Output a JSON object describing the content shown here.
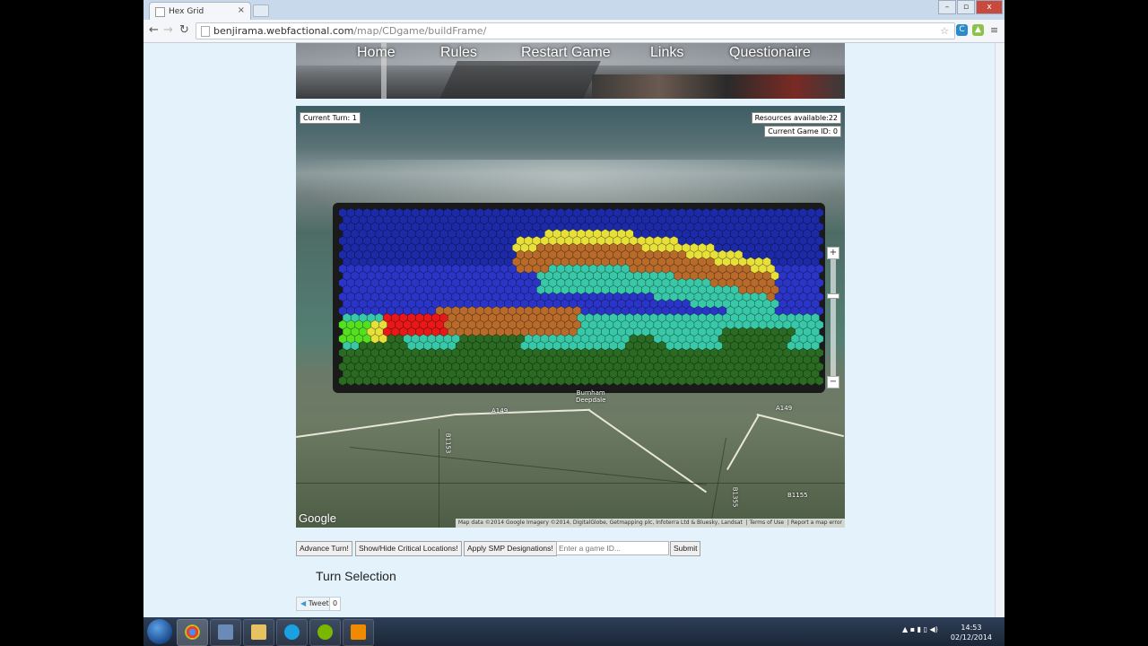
{
  "browser": {
    "tab_title": "Hex Grid",
    "tab_close": "×",
    "url_host": "benjirama.webfactional.com",
    "url_path": "/map/CDgame/buildFrame/",
    "win_min": "–",
    "win_max": "▫",
    "win_close": "x"
  },
  "nav": {
    "items": [
      "Home",
      "Rules",
      "Restart Game",
      "Links",
      "Questionaire"
    ]
  },
  "map": {
    "current_turn": "Current Turn: 1",
    "resources": "Resources available:22",
    "game_id": "Current Game ID: 0",
    "place_label": "Burnham\nDeepdale",
    "road_labels": [
      "A149",
      "A149",
      "B1153",
      "B1155",
      "B1355"
    ],
    "google_logo": "Google",
    "attribution": "Map data ©2014 Google Imagery ©2014, DigitalGlobe, Getmapping plc, Infoterra Ltd & Bluesky, Landsat",
    "terms": "Terms of Use",
    "report": "Report a map error",
    "zoom_in": "+",
    "zoom_out": "−"
  },
  "controls": {
    "advance": "Advance Turn!",
    "show_hide": "Show/Hide Critical Locations!",
    "apply_smp": "Apply SMP Designations!",
    "game_id_placeholder": "Enter a game ID...",
    "submit": "Submit"
  },
  "content": {
    "turn_selection": "Turn Selection",
    "tweet": "Tweet",
    "tweet_count": "0"
  },
  "taskbar": {
    "time": "14:53",
    "date": "02/12/2014"
  },
  "colors": {
    "sea": "#2a35c8",
    "deep_sea": "#1d2aa8",
    "sand": "#b86a2a",
    "yellow": "#e8e03a",
    "teal": "#38c8a8",
    "green": "#2a6a22",
    "lime": "#54e020",
    "red": "#e81818"
  }
}
